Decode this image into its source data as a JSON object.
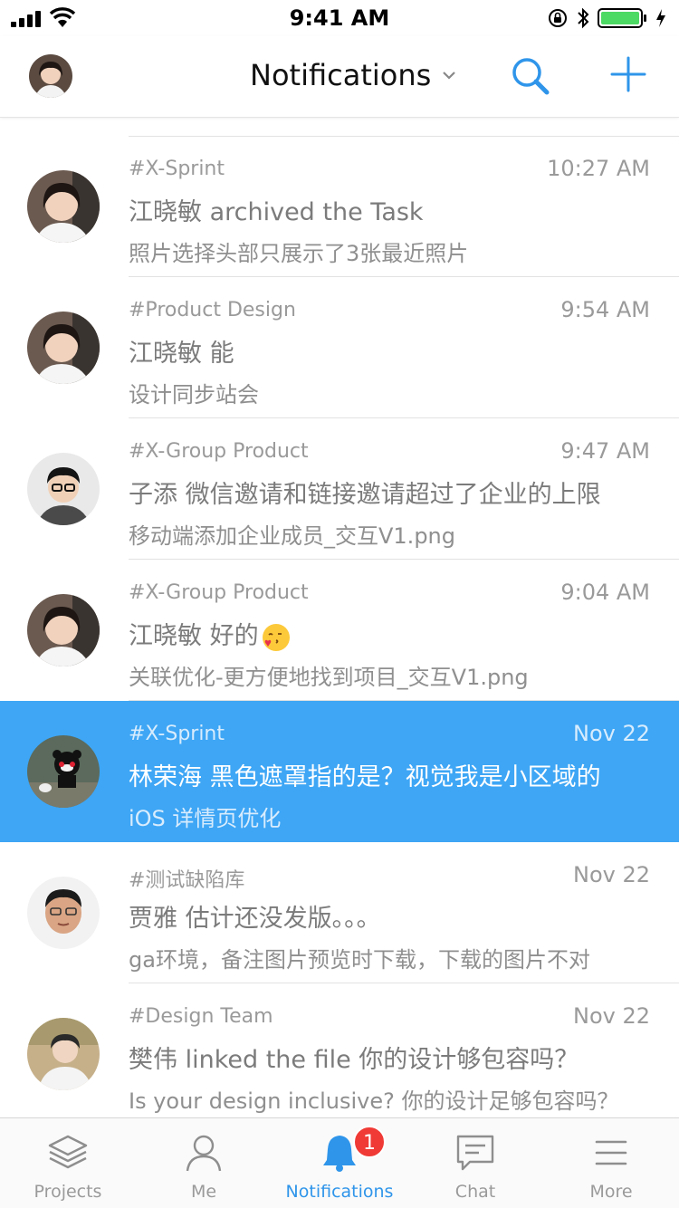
{
  "status_bar": {
    "time": "9:41 AM"
  },
  "nav": {
    "title": "Notifications",
    "icons": [
      "avatar",
      "chevron-down-icon",
      "search-icon",
      "plus-icon"
    ]
  },
  "notifications": [
    {
      "group": "#X-Sprint",
      "time": "10:27 AM",
      "title": "江晓敏 archived the Task",
      "subtitle": "照片选择头部只展示了3张最近照片",
      "avatar": "woman-avatar"
    },
    {
      "group": "#Product Design",
      "time": "9:54 AM",
      "title": "江晓敏 能",
      "subtitle": "设计同步站会",
      "avatar": "woman-avatar"
    },
    {
      "group": "#X-Group Product",
      "time": "9:47 AM",
      "title": "子添 微信邀请和链接邀请超过了企业的上限",
      "subtitle": "移动端添加企业成员_交互V1.png",
      "avatar": "man-glasses-avatar"
    },
    {
      "group": "#X-Group Product",
      "time": "9:04 AM",
      "title": "江晓敏 好的",
      "subtitle": "关联优化-更方便地找到项目_交互V1.png",
      "avatar": "woman-avatar",
      "emoji": "kiss-emoji"
    },
    {
      "group": "#X-Sprint",
      "time": "Nov 22",
      "title": "林荣海 黑色遮罩指的是？视觉我是小区域的",
      "subtitle": "iOS 详情页优化",
      "avatar": "bear-avatar",
      "active": true
    },
    {
      "group": "#测试缺陷库",
      "time": "Nov 22",
      "title": "贾雅 估计还没发版。。。",
      "subtitle": "ga环境，备注图片预览时下载，下载的图片不对",
      "avatar": "man-avatar"
    },
    {
      "group": "#Design Team",
      "time": "Nov 22",
      "title": "樊伟 linked the file 你的设计够包容吗？",
      "subtitle": "Is your design inclusive? 你的设计足够包容吗？",
      "avatar": "person-avatar"
    }
  ],
  "tab_bar": {
    "tabs": [
      {
        "label": "Projects",
        "icon": "layers-icon"
      },
      {
        "label": "Me",
        "icon": "person-icon"
      },
      {
        "label": "Notifications",
        "icon": "bell-icon",
        "badge": "1",
        "active": true
      },
      {
        "label": "Chat",
        "icon": "chat-bubble-icon"
      },
      {
        "label": "More",
        "icon": "menu-icon"
      }
    ]
  },
  "colors": {
    "accent": "#3ea6f5",
    "tab_active": "#2f95ea",
    "badge": "#f03a35",
    "battery": "#4cd964"
  }
}
